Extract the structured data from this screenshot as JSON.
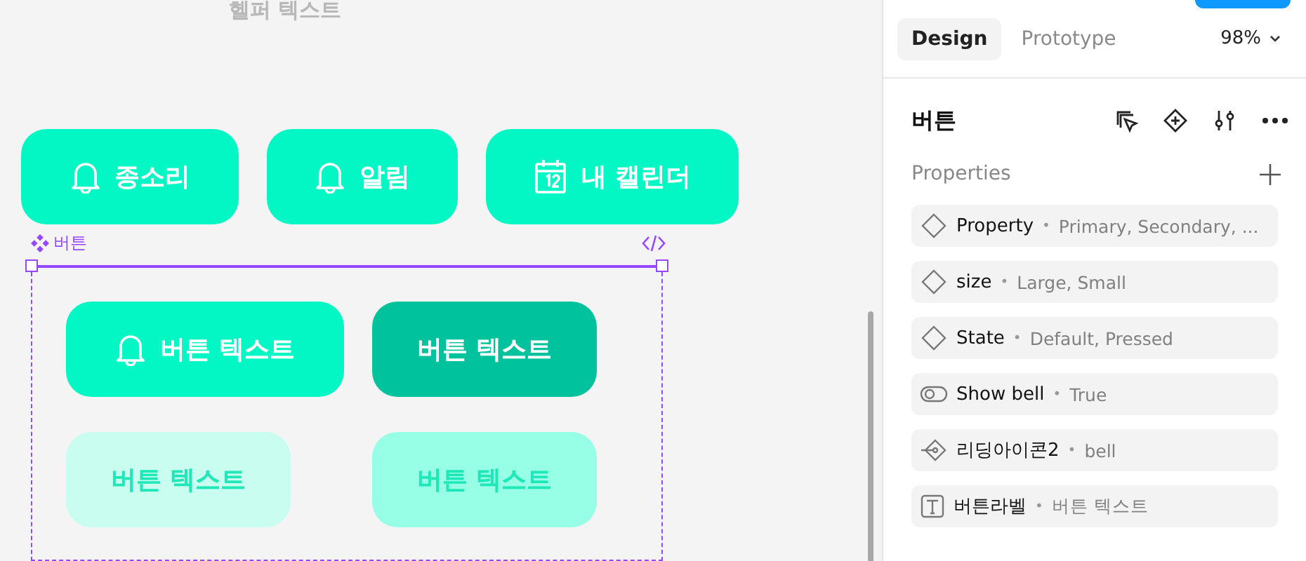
{
  "canvas": {
    "helper_text": "헬퍼 텍스트",
    "buttons": [
      {
        "label": "종소리",
        "kind": "bell"
      },
      {
        "label": "알림",
        "kind": "bell"
      },
      {
        "label": "내 캘린더",
        "kind": "calendar"
      }
    ],
    "component": {
      "name": "버튼",
      "variants": [
        {
          "label": "버튼 텍스트",
          "kind": "default",
          "show_bell": true
        },
        {
          "label": "버튼 텍스트",
          "kind": "pressed",
          "show_bell": false
        },
        {
          "label": "버튼 텍스트",
          "kind": "light",
          "show_bell": false
        },
        {
          "label": "버튼 텍스트",
          "kind": "light-pressed",
          "show_bell": false
        }
      ]
    }
  },
  "panel": {
    "tabs": [
      {
        "label": "Design",
        "selected": true
      },
      {
        "label": "Prototype",
        "selected": false
      }
    ],
    "zoom": "98%",
    "title": "버튼",
    "section": "Properties",
    "properties": [
      {
        "kind": "variant",
        "name": "Property",
        "separator": "•",
        "value": "Primary, Secondary, ..."
      },
      {
        "kind": "variant",
        "name": "size",
        "separator": "•",
        "value": "Large, Small"
      },
      {
        "kind": "variant",
        "name": "State",
        "separator": "•",
        "value": "Default, Pressed"
      },
      {
        "kind": "boolean",
        "name": "Show bell",
        "separator": "•",
        "value": "True"
      },
      {
        "kind": "instance",
        "name": "리딩아이콘2",
        "separator": "•",
        "value": "bell"
      },
      {
        "kind": "text",
        "name": "버튼라벨",
        "separator": "•",
        "value": "버튼 텍스트"
      }
    ]
  }
}
